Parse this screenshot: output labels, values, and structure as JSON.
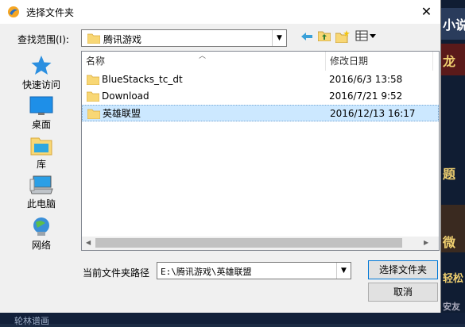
{
  "window": {
    "title": "选择文件夹",
    "close_glyph": "✕"
  },
  "lookin": {
    "label": "查找范围(I):",
    "value": "腾讯游戏"
  },
  "toolbar": [
    "back-icon",
    "up-folder-icon",
    "new-folder-icon",
    "view-menu-icon"
  ],
  "places": [
    {
      "label": "快速访问",
      "icon": "star-icon"
    },
    {
      "label": "桌面",
      "icon": "desktop-icon"
    },
    {
      "label": "库",
      "icon": "library-icon"
    },
    {
      "label": "此电脑",
      "icon": "computer-icon"
    },
    {
      "label": "网络",
      "icon": "network-icon"
    }
  ],
  "filelist": {
    "headers": {
      "name": "名称",
      "modified": "修改日期"
    },
    "rows": [
      {
        "name": "BlueStacks_tc_dt",
        "modified": "2016/6/3 13:58",
        "selected": false
      },
      {
        "name": "Download",
        "modified": "2016/7/21 9:52",
        "selected": false
      },
      {
        "name": "英雄联盟",
        "modified": "2016/12/13 16:17",
        "selected": true
      }
    ]
  },
  "path": {
    "label": "当前文件夹路径",
    "value": "E:\\腾讯游戏\\英雄联盟"
  },
  "buttons": {
    "select": "选择文件夹",
    "cancel": "取消"
  },
  "background": {
    "bottom_text": "轮林谱画",
    "snippets": [
      "小说",
      "龙",
      "题",
      "微",
      "轻松",
      "安友"
    ]
  },
  "colors": {
    "selection": "#cce8ff",
    "folder": "#f8d775",
    "accent": "#0078d7"
  }
}
